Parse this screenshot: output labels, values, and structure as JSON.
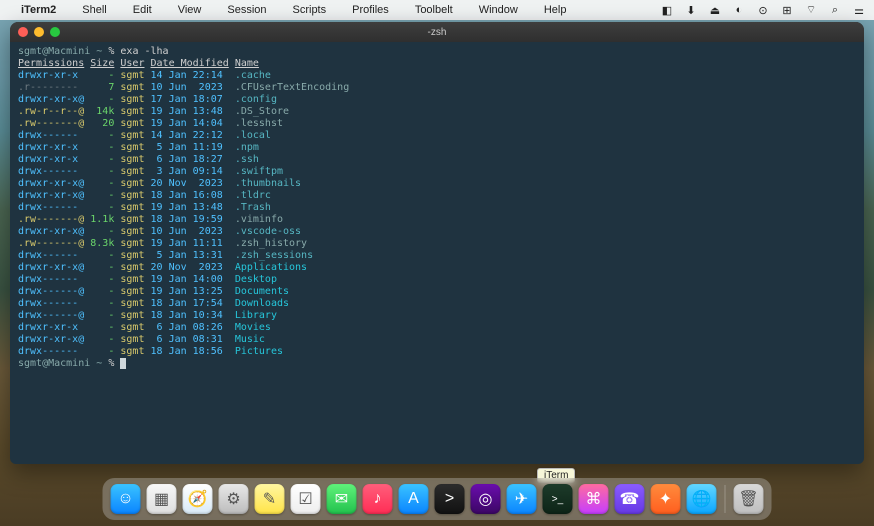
{
  "menubar": {
    "app": "iTerm2",
    "items": [
      "Shell",
      "Edit",
      "View",
      "Session",
      "Scripts",
      "Profiles",
      "Toolbelt",
      "Window",
      "Help"
    ]
  },
  "window": {
    "title": "-zsh"
  },
  "prompt_line": {
    "user_host": "sgmt@Macmini",
    "path": "~",
    "sym": "%",
    "cmd": "exa -lha"
  },
  "headers": {
    "perm": "Permissions",
    "size": "Size",
    "user": "User",
    "date": "Date Modified",
    "name": "Name"
  },
  "rows": [
    {
      "perm": "drwxr-xr-x ",
      "pc": "blue",
      "size": "   -",
      "user": "sgmt",
      "date": "14 Jan 22:14",
      "name": ".cache",
      "nc": "teal"
    },
    {
      "perm": ".r--------",
      "pc": "grey",
      "size": "   7",
      "user": "sgmt",
      "date": "10 Jun  2023",
      "name": ".CFUserTextEncoding",
      "nc": "dim"
    },
    {
      "perm": "drwxr-xr-x@",
      "pc": "blue",
      "size": "   -",
      "user": "sgmt",
      "date": "17 Jan 18:07",
      "name": ".config",
      "nc": "teal"
    },
    {
      "perm": ".rw-r--r--@",
      "pc": "yellow",
      "size": " 14k",
      "user": "sgmt",
      "date": "19 Jan 13:48",
      "name": ".DS_Store",
      "nc": "dim"
    },
    {
      "perm": ".rw-------@",
      "pc": "yellow",
      "size": "  20",
      "user": "sgmt",
      "date": "19 Jan 14:04",
      "name": ".lesshst",
      "nc": "dim"
    },
    {
      "perm": "drwx------ ",
      "pc": "blue",
      "size": "   -",
      "user": "sgmt",
      "date": "14 Jan 22:12",
      "name": ".local",
      "nc": "teal"
    },
    {
      "perm": "drwxr-xr-x ",
      "pc": "blue",
      "size": "   -",
      "user": "sgmt",
      "date": " 5 Jan 11:19",
      "name": ".npm",
      "nc": "teal"
    },
    {
      "perm": "drwxr-xr-x ",
      "pc": "blue",
      "size": "   -",
      "user": "sgmt",
      "date": " 6 Jan 18:27",
      "name": ".ssh",
      "nc": "teal"
    },
    {
      "perm": "drwx------ ",
      "pc": "blue",
      "size": "   -",
      "user": "sgmt",
      "date": " 3 Jan 09:14",
      "name": ".swiftpm",
      "nc": "teal"
    },
    {
      "perm": "drwxr-xr-x@",
      "pc": "blue",
      "size": "   -",
      "user": "sgmt",
      "date": "20 Nov  2023",
      "name": ".thumbnails",
      "nc": "teal"
    },
    {
      "perm": "drwxr-xr-x@",
      "pc": "blue",
      "size": "   -",
      "user": "sgmt",
      "date": "18 Jan 16:08",
      "name": ".tldrc",
      "nc": "teal"
    },
    {
      "perm": "drwx------ ",
      "pc": "blue",
      "size": "   -",
      "user": "sgmt",
      "date": "19 Jan 13:48",
      "name": ".Trash",
      "nc": "teal"
    },
    {
      "perm": ".rw-------@",
      "pc": "yellow",
      "size": "1.1k",
      "user": "sgmt",
      "date": "18 Jan 19:59",
      "name": ".viminfo",
      "nc": "dim"
    },
    {
      "perm": "drwxr-xr-x@",
      "pc": "blue",
      "size": "   -",
      "user": "sgmt",
      "date": "10 Jun  2023",
      "name": ".vscode-oss",
      "nc": "teal"
    },
    {
      "perm": ".rw-------@",
      "pc": "yellow",
      "size": "8.3k",
      "user": "sgmt",
      "date": "19 Jan 11:11",
      "name": ".zsh_history",
      "nc": "dim"
    },
    {
      "perm": "drwx------ ",
      "pc": "blue",
      "size": "   -",
      "user": "sgmt",
      "date": " 5 Jan 13:31",
      "name": ".zsh_sessions",
      "nc": "teal"
    },
    {
      "perm": "drwxr-xr-x@",
      "pc": "blue",
      "size": "   -",
      "user": "sgmt",
      "date": "20 Nov  2023",
      "name": "Applications",
      "nc": "cyan"
    },
    {
      "perm": "drwx------ ",
      "pc": "blue",
      "size": "   -",
      "user": "sgmt",
      "date": "19 Jan 14:00",
      "name": "Desktop",
      "nc": "cyan"
    },
    {
      "perm": "drwx------@",
      "pc": "blue",
      "size": "   -",
      "user": "sgmt",
      "date": "19 Jan 13:25",
      "name": "Documents",
      "nc": "cyan"
    },
    {
      "perm": "drwx------ ",
      "pc": "blue",
      "size": "   -",
      "user": "sgmt",
      "date": "18 Jan 17:54",
      "name": "Downloads",
      "nc": "cyan"
    },
    {
      "perm": "drwx------@",
      "pc": "blue",
      "size": "   -",
      "user": "sgmt",
      "date": "18 Jan 10:34",
      "name": "Library",
      "nc": "cyan"
    },
    {
      "perm": "drwxr-xr-x ",
      "pc": "blue",
      "size": "   -",
      "user": "sgmt",
      "date": " 6 Jan 08:26",
      "name": "Movies",
      "nc": "cyan"
    },
    {
      "perm": "drwxr-xr-x@",
      "pc": "blue",
      "size": "   -",
      "user": "sgmt",
      "date": " 6 Jan 08:31",
      "name": "Music",
      "nc": "cyan"
    },
    {
      "perm": "drwx------ ",
      "pc": "blue",
      "size": "   -",
      "user": "sgmt",
      "date": "18 Jan 18:56",
      "name": "Pictures",
      "nc": "cyan"
    }
  ],
  "prompt2": {
    "user_host": "sgmt@Macmini",
    "path": "~",
    "sym": "%"
  },
  "tooltip": "iTerm",
  "dock": [
    {
      "name": "finder",
      "bg": "linear-gradient(#3ac3ff,#0a84ff)",
      "glyph": "☺"
    },
    {
      "name": "launchpad",
      "bg": "linear-gradient(#f7f7f7,#dedede)",
      "glyph": "▦"
    },
    {
      "name": "safari",
      "bg": "linear-gradient(#ffffff,#d9eaf7)",
      "glyph": "🧭"
    },
    {
      "name": "settings",
      "bg": "linear-gradient(#e8e8e8,#bcbcbc)",
      "glyph": "⚙"
    },
    {
      "name": "notes",
      "bg": "linear-gradient(#fff6a0,#ffe448)",
      "glyph": "✎"
    },
    {
      "name": "reminders",
      "bg": "linear-gradient(#ffffff,#eeeeee)",
      "glyph": "☑"
    },
    {
      "name": "messages",
      "bg": "linear-gradient(#5ff27a,#22c14d)",
      "glyph": "✉"
    },
    {
      "name": "music",
      "bg": "linear-gradient(#ff5e7b,#ff2d55)",
      "glyph": "♪"
    },
    {
      "name": "appstore",
      "bg": "linear-gradient(#3ac3ff,#0a84ff)",
      "glyph": "A"
    },
    {
      "name": "terminal",
      "bg": "linear-gradient(#2c2c2c,#111)",
      "glyph": ">"
    },
    {
      "name": "orbit",
      "bg": "linear-gradient(#6a0dad,#3b0764)",
      "glyph": "◎"
    },
    {
      "name": "telegram",
      "bg": "linear-gradient(#3ac3ff,#0a84ff)",
      "glyph": "✈"
    },
    {
      "name": "iterm",
      "bg": "linear-gradient(#1d3b2a,#0d2417)",
      "glyph": ">_"
    },
    {
      "name": "shortcuts",
      "bg": "linear-gradient(#ff6ba0,#c53dff)",
      "glyph": "⌘"
    },
    {
      "name": "viber",
      "bg": "linear-gradient(#8a5cff,#6639e4)",
      "glyph": "☎"
    },
    {
      "name": "photoeditor",
      "bg": "linear-gradient(#ff8b3d,#ff5e1f)",
      "glyph": "✦"
    },
    {
      "name": "network",
      "bg": "linear-gradient(#62d6ff,#0aa6ff)",
      "glyph": "🌐"
    },
    {
      "name": "trash",
      "bg": "linear-gradient(#d8d8d8,#bfbfbf)",
      "glyph": "🗑"
    }
  ]
}
